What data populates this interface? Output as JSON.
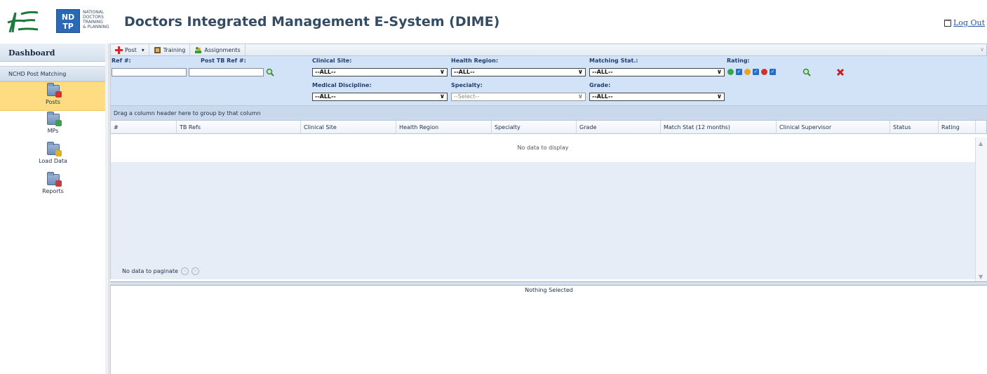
{
  "header": {
    "ndtp_logo": "ND TP",
    "ndtp_text": [
      "NATIONAL",
      "DOCTORS",
      "TRAINING",
      "& PLANNING"
    ],
    "app_title": "Doctors Integrated Management E-System (DIME)",
    "logout": "Log Out"
  },
  "sidebar": {
    "dashboard": "Dashboard",
    "group": "NCHD Post Matching",
    "items": [
      {
        "label": "Posts",
        "icon": "posts-folder-icon"
      },
      {
        "label": "MPs",
        "icon": "mps-folder-icon"
      },
      {
        "label": "Load Data",
        "icon": "load-data-folder-icon"
      },
      {
        "label": "Reports",
        "icon": "reports-folder-icon"
      }
    ]
  },
  "toolbar": {
    "post": "Post",
    "training": "Training",
    "assignments": "Assignments"
  },
  "filters": {
    "ref_label": "Ref #:",
    "post_tb_ref_label": "Post TB Ref #:",
    "clinical_site_label": "Clinical Site:",
    "clinical_site_value": "--ALL--",
    "health_region_label": "Health Region:",
    "health_region_value": "--ALL--",
    "matching_stat_label": "Matching Stat.:",
    "matching_stat_value": "--ALL--",
    "rating_label": "Rating:",
    "medical_discipline_label": "Medical Discipline:",
    "medical_discipline_value": "--ALL--",
    "specialty_label": "Specialty:",
    "specialty_value": "--Select--",
    "grade_label": "Grade:",
    "grade_value": "--ALL--"
  },
  "grid": {
    "group_hint": "Drag a column header here to group by that column",
    "columns": [
      "#",
      "TB Refs",
      "Clinical Site",
      "Health Region",
      "Specialty",
      "Grade",
      "Match Stat (12 months)",
      "Clinical Supervisor",
      "Status",
      "Rating"
    ],
    "empty": "No data to display",
    "pager": "No data to paginate"
  },
  "detail": {
    "empty": "Nothing Selected"
  },
  "colors": {
    "accent": "#d3e3f7",
    "active_item": "#fedc81",
    "title": "#344c63"
  }
}
